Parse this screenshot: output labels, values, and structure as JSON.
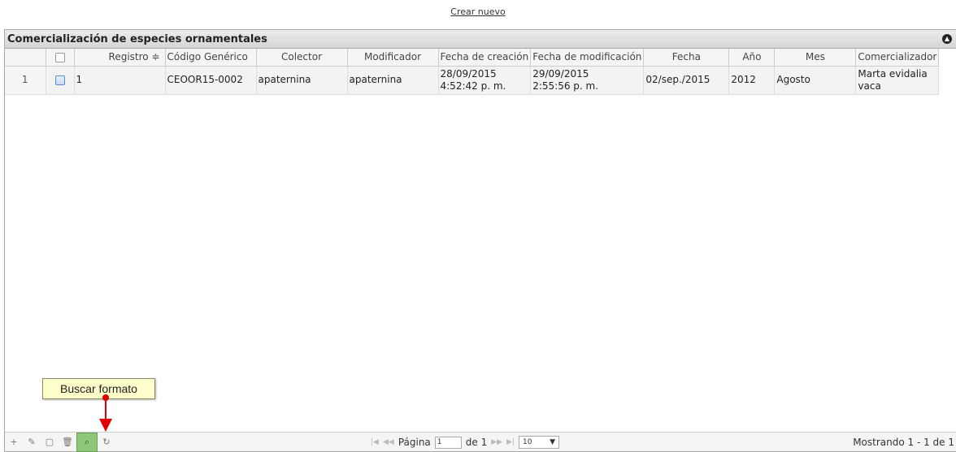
{
  "top_link": "Crear nuevo",
  "grid": {
    "caption": "Comercialización de especies ornamentales",
    "columns": [
      {
        "label": ""
      },
      {
        "label": ""
      },
      {
        "label": "Registro ≑"
      },
      {
        "label": "Código Genérico"
      },
      {
        "label": "Colector"
      },
      {
        "label": "Modificador"
      },
      {
        "label": "Fecha de creación"
      },
      {
        "label": "Fecha de modificación"
      },
      {
        "label": "Fecha"
      },
      {
        "label": "Año"
      },
      {
        "label": "Mes"
      },
      {
        "label": "Comercializador"
      }
    ],
    "rows": [
      {
        "num": "1",
        "registro": "1",
        "codigo": "CEOOR15-0002",
        "colector": "apaternina",
        "modificador": "apaternina",
        "creacion_date": "28/09/2015",
        "creacion_time": "4:52:42 p. m.",
        "modif_date": "29/09/2015",
        "modif_time": "2:55:56 p. m.",
        "fecha": "02/sep./2015",
        "anio": "2012",
        "mes": "Agosto",
        "comercializador_1": "Marta evidalia",
        "comercializador_2": "vaca"
      }
    ]
  },
  "pager": {
    "page_label": "Página",
    "page_value": "1",
    "of_label": "de 1",
    "rows_per_page": "10",
    "records": "Mostrando 1 - 1 de 1"
  },
  "tooltip": "Buscar formato",
  "colors": {
    "arrow": "#e00000",
    "search_active": "#8fc77a",
    "tooltip_bg": "#ffffcc"
  }
}
